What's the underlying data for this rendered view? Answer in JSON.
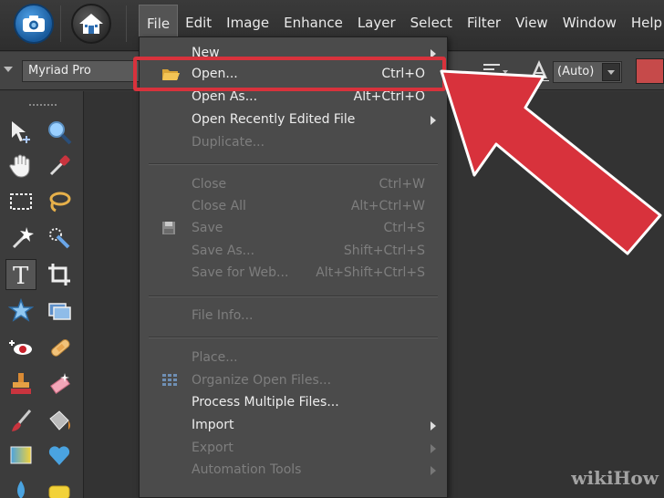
{
  "menubar": {
    "items": [
      "File",
      "Edit",
      "Image",
      "Enhance",
      "Layer",
      "Select",
      "Filter",
      "View",
      "Window",
      "Help"
    ],
    "active": "File"
  },
  "options": {
    "font_name": "Myriad Pro",
    "leading_value": "(Auto)"
  },
  "file_menu": {
    "items": [
      {
        "label": "New",
        "shortcut": "",
        "submenu": true,
        "enabled": true
      },
      {
        "label": "Open...",
        "shortcut": "Ctrl+O",
        "submenu": false,
        "enabled": true,
        "highlighted": true
      },
      {
        "label": "Open As...",
        "shortcut": "Alt+Ctrl+O",
        "submenu": false,
        "enabled": true
      },
      {
        "label": "Open Recently Edited File",
        "shortcut": "",
        "submenu": true,
        "enabled": true
      },
      {
        "label": "Duplicate...",
        "shortcut": "",
        "submenu": false,
        "enabled": false
      },
      {
        "label": "Close",
        "shortcut": "Ctrl+W",
        "submenu": false,
        "enabled": false
      },
      {
        "label": "Close All",
        "shortcut": "Alt+Ctrl+W",
        "submenu": false,
        "enabled": false
      },
      {
        "label": "Save",
        "shortcut": "Ctrl+S",
        "submenu": false,
        "enabled": false
      },
      {
        "label": "Save As...",
        "shortcut": "Shift+Ctrl+S",
        "submenu": false,
        "enabled": false
      },
      {
        "label": "Save for Web...",
        "shortcut": "Alt+Shift+Ctrl+S",
        "submenu": false,
        "enabled": false
      },
      {
        "label": "File Info...",
        "shortcut": "",
        "submenu": false,
        "enabled": false
      },
      {
        "label": "Place...",
        "shortcut": "",
        "submenu": false,
        "enabled": false
      },
      {
        "label": "Organize Open Files...",
        "shortcut": "",
        "submenu": false,
        "enabled": false
      },
      {
        "label": "Process Multiple Files...",
        "shortcut": "",
        "submenu": false,
        "enabled": true
      },
      {
        "label": "Import",
        "shortcut": "",
        "submenu": true,
        "enabled": true
      },
      {
        "label": "Export",
        "shortcut": "",
        "submenu": true,
        "enabled": false
      },
      {
        "label": "Automation Tools",
        "shortcut": "",
        "submenu": true,
        "enabled": false
      }
    ]
  },
  "colors": {
    "highlight": "#d8323c",
    "arrow": "#d8323c",
    "foreground_swatch": "#c64a4a"
  },
  "watermark": "wikiHow"
}
